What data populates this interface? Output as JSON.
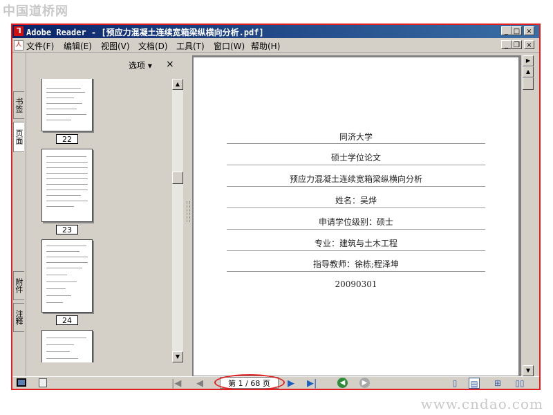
{
  "watermark": {
    "top": "中国道桥网",
    "bottom": "www.cndao.com"
  },
  "window": {
    "title": "Adobe Reader - [预应力混凝土连续宽箱梁纵横向分析.pdf]",
    "controls": [
      "_",
      "□",
      "×"
    ],
    "doc_controls": [
      "_",
      "❐",
      "×"
    ]
  },
  "menu": [
    "文件(F)",
    "编辑(E)",
    "视图(V)",
    "文档(D)",
    "工具(T)",
    "窗口(W)",
    "帮助(H)"
  ],
  "left_tabs": [
    "书签",
    "页面",
    "附件",
    "注释"
  ],
  "panel": {
    "options_label": "选项 ▾",
    "close": "×"
  },
  "thumbnails": [
    {
      "label": "22"
    },
    {
      "label": "23"
    },
    {
      "label": "24"
    },
    {
      "label": ""
    }
  ],
  "document_lines": [
    "同济大学",
    "硕士学位论文",
    "预应力混凝土连续宽箱梁纵横向分析",
    "姓名：吴烨",
    "申请学位级别：硕士",
    "专业：建筑与土木工程",
    "指导教师：徐栋;程泽坤",
    "20090301"
  ],
  "statusbar": {
    "page_display": "第 1 / 68 页",
    "nav": {
      "first": "|◀",
      "prev": "◀",
      "next": "▶",
      "last": "▶|"
    }
  },
  "colors": {
    "title_start": "#0a246a",
    "title_end": "#3a6ea5",
    "annotation": "#e02020"
  }
}
